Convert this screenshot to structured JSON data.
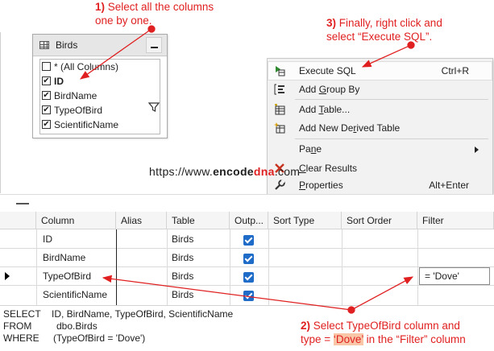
{
  "annotations": {
    "step1_num": "1)",
    "step1_line1": "Select all the columns",
    "step1_line2": "one by one.",
    "step3_num": "3)",
    "step3_line1": "Finally, right click and",
    "step3_line2": "select “Execute SQL”.",
    "step2_num": "2)",
    "step2_line1": "Select TypeOfBird column and",
    "step2_line2a": "type = ",
    "step2_line2b": "‘Dove’",
    "step2_line2c": " in the “Filter” column"
  },
  "table_widget": {
    "title": "Birds",
    "columns": [
      {
        "label": "* (All Columns)",
        "checked": false,
        "bold": false
      },
      {
        "label": "ID",
        "checked": true,
        "bold": true
      },
      {
        "label": "BirdName",
        "checked": true,
        "bold": false
      },
      {
        "label": "TypeOfBird",
        "checked": true,
        "bold": false
      },
      {
        "label": "ScientificName",
        "checked": true,
        "bold": false
      }
    ]
  },
  "context_menu": {
    "items": [
      {
        "label": "Execute SQL",
        "shortcut": "Ctrl+R",
        "icon": "execute-sql-icon"
      },
      {
        "label": "Add Group By",
        "shortcut": "",
        "icon": "group-by-icon"
      },
      {
        "label": "Add Table...",
        "shortcut": "",
        "icon": "add-table-icon"
      },
      {
        "label": "Add New Derived Table",
        "shortcut": "",
        "icon": "derived-table-icon"
      },
      {
        "label": "Pane",
        "shortcut": "",
        "icon": ""
      },
      {
        "label": "Clear Results",
        "shortcut": "",
        "icon": "clear-results-icon"
      },
      {
        "label": "Properties",
        "shortcut": "Alt+Enter",
        "icon": "properties-icon"
      }
    ]
  },
  "watermark": {
    "prefix": "https://www.",
    "brand_a": "encode",
    "brand_b": "dna",
    "suffix": ".com"
  },
  "criteria_grid": {
    "headers": [
      "Column",
      "Alias",
      "Table",
      "Outp...",
      "Sort Type",
      "Sort Order",
      "Filter"
    ],
    "rows": [
      {
        "column": "ID",
        "alias": "",
        "table": "Birds",
        "output": true,
        "filter": ""
      },
      {
        "column": "BirdName",
        "alias": "",
        "table": "Birds",
        "output": true,
        "filter": ""
      },
      {
        "column": "TypeOfBird",
        "alias": "",
        "table": "Birds",
        "output": true,
        "filter": "= 'Dove'"
      },
      {
        "column": "ScientificName",
        "alias": "",
        "table": "Birds",
        "output": true,
        "filter": ""
      }
    ]
  },
  "sql_pane": {
    "select_kw": "SELECT",
    "select_txt": "ID, BirdName, TypeOfBird, ScientificName",
    "from_kw": "FROM",
    "from_txt": "dbo.Birds",
    "where_kw": "WHERE",
    "where_txt": "(TypeOfBird = 'Dove')"
  },
  "colors": {
    "annotation_red": "#e02020",
    "checkbox_blue": "#1f6cc8",
    "highlight": "#f9c7a8"
  }
}
